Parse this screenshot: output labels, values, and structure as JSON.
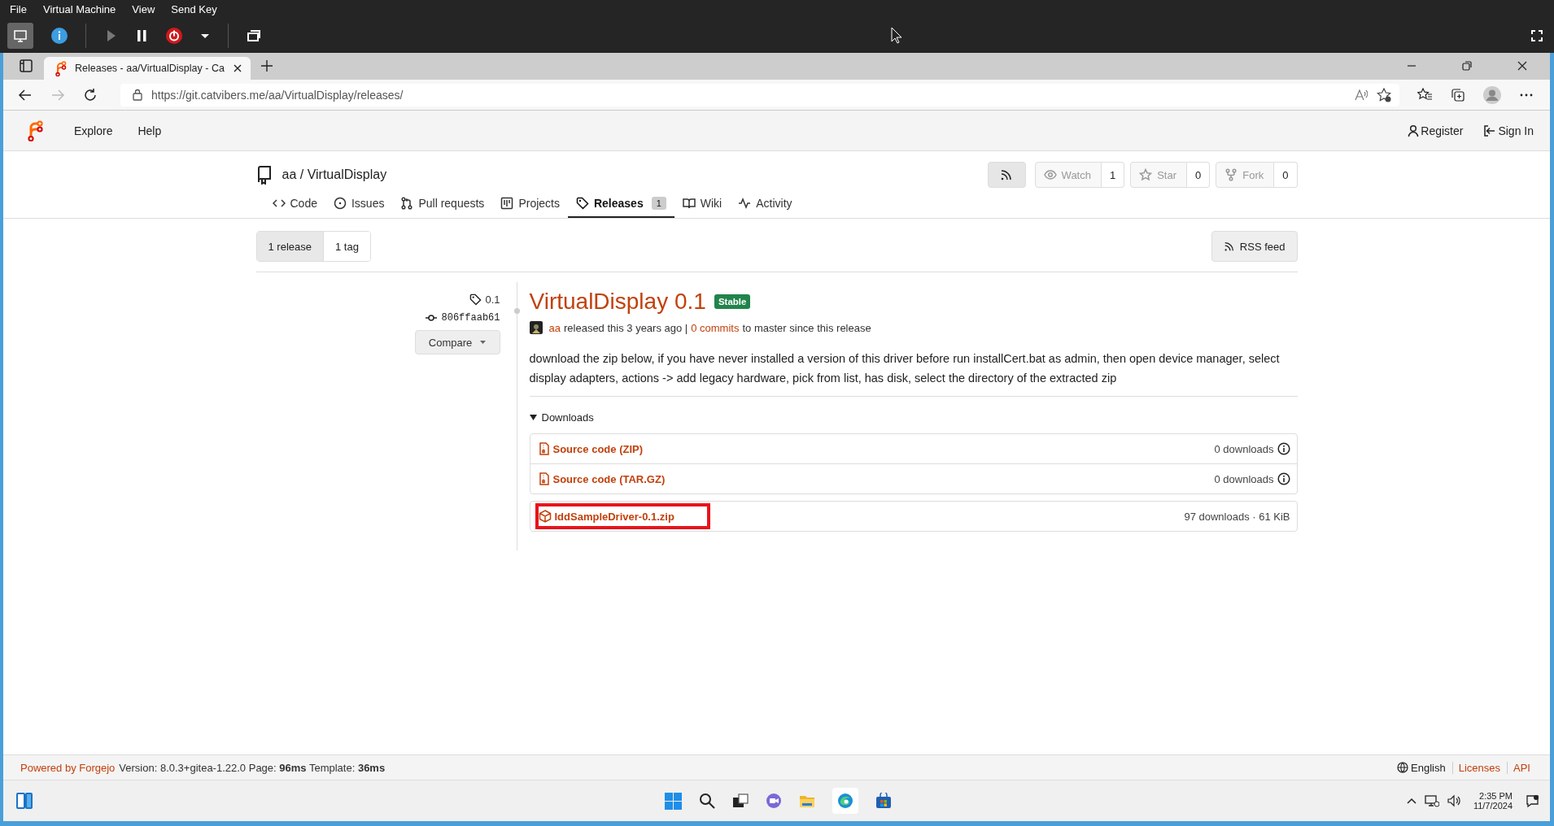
{
  "vm": {
    "menu": [
      "File",
      "Virtual Machine",
      "View",
      "Send Key"
    ]
  },
  "browser": {
    "tab_title": "Releases - aa/VirtualDisplay - Ca",
    "url": "https://git.catvibers.me/aa/VirtualDisplay/releases/"
  },
  "navbar": {
    "left": [
      "Explore",
      "Help"
    ],
    "right": [
      {
        "kind": "register",
        "label": "Register"
      },
      {
        "kind": "signin",
        "label": "Sign In"
      }
    ]
  },
  "repo": {
    "title": "aa / VirtualDisplay",
    "actions": [
      {
        "kind": "rss"
      },
      {
        "kind": "watch",
        "label": "Watch",
        "count": "1"
      },
      {
        "kind": "star",
        "label": "Star",
        "count": "0"
      },
      {
        "kind": "fork",
        "label": "Fork",
        "count": "0"
      }
    ],
    "tabs": [
      {
        "kind": "code",
        "label": "Code",
        "selected": false
      },
      {
        "kind": "issues",
        "label": "Issues",
        "selected": false
      },
      {
        "kind": "pulls",
        "label": "Pull requests",
        "selected": false
      },
      {
        "kind": "projects",
        "label": "Projects",
        "selected": false
      },
      {
        "kind": "releases",
        "label": "Releases",
        "count": "1",
        "selected": true
      },
      {
        "kind": "wiki",
        "label": "Wiki",
        "selected": false
      },
      {
        "kind": "activity",
        "label": "Activity",
        "selected": false
      }
    ]
  },
  "filter": [
    {
      "label": "1 release",
      "selected": true
    },
    {
      "label": "1 tag",
      "selected": false
    }
  ],
  "rss_button": "RSS feed",
  "release": {
    "tag": "0.1",
    "commit": "806ffaab61",
    "compare": "Compare",
    "title": "VirtualDisplay 0.1",
    "badge": "Stable",
    "author": "aa",
    "meta_1": "released this 3 years ago |",
    "commits_link": "0 commits",
    "meta_2": "to master since this release",
    "description": "download the zip below, if you have never installed a version of this driver before run installCert.bat as admin, then open device manager, select display adapters, actions -> add legacy hardware, pick from list, has disk, select the directory of the extracted zip",
    "downloads": {
      "label": "Downloads",
      "expanded": true,
      "groups": [
        [
          {
            "kind": "source",
            "name": "Source code (ZIP)",
            "info": "0 downloads",
            "highlighted": false
          },
          {
            "kind": "source",
            "name": "Source code (TAR.GZ)",
            "info": "0 downloads",
            "highlighted": false
          }
        ],
        [
          {
            "kind": "package",
            "name": "IddSampleDriver-0.1.zip",
            "info": "97 downloads · 61 KiB",
            "highlighted": true
          }
        ]
      ]
    }
  },
  "footer": {
    "powered": "Powered by Forgejo",
    "version": "Version: 8.0.3+gitea-1.22.0 Page: **96ms** Template: **36ms**",
    "language": "English",
    "links": [
      "Licenses",
      "API"
    ]
  },
  "taskbar": {
    "time": "2:35 PM",
    "date": "11/7/2024"
  }
}
